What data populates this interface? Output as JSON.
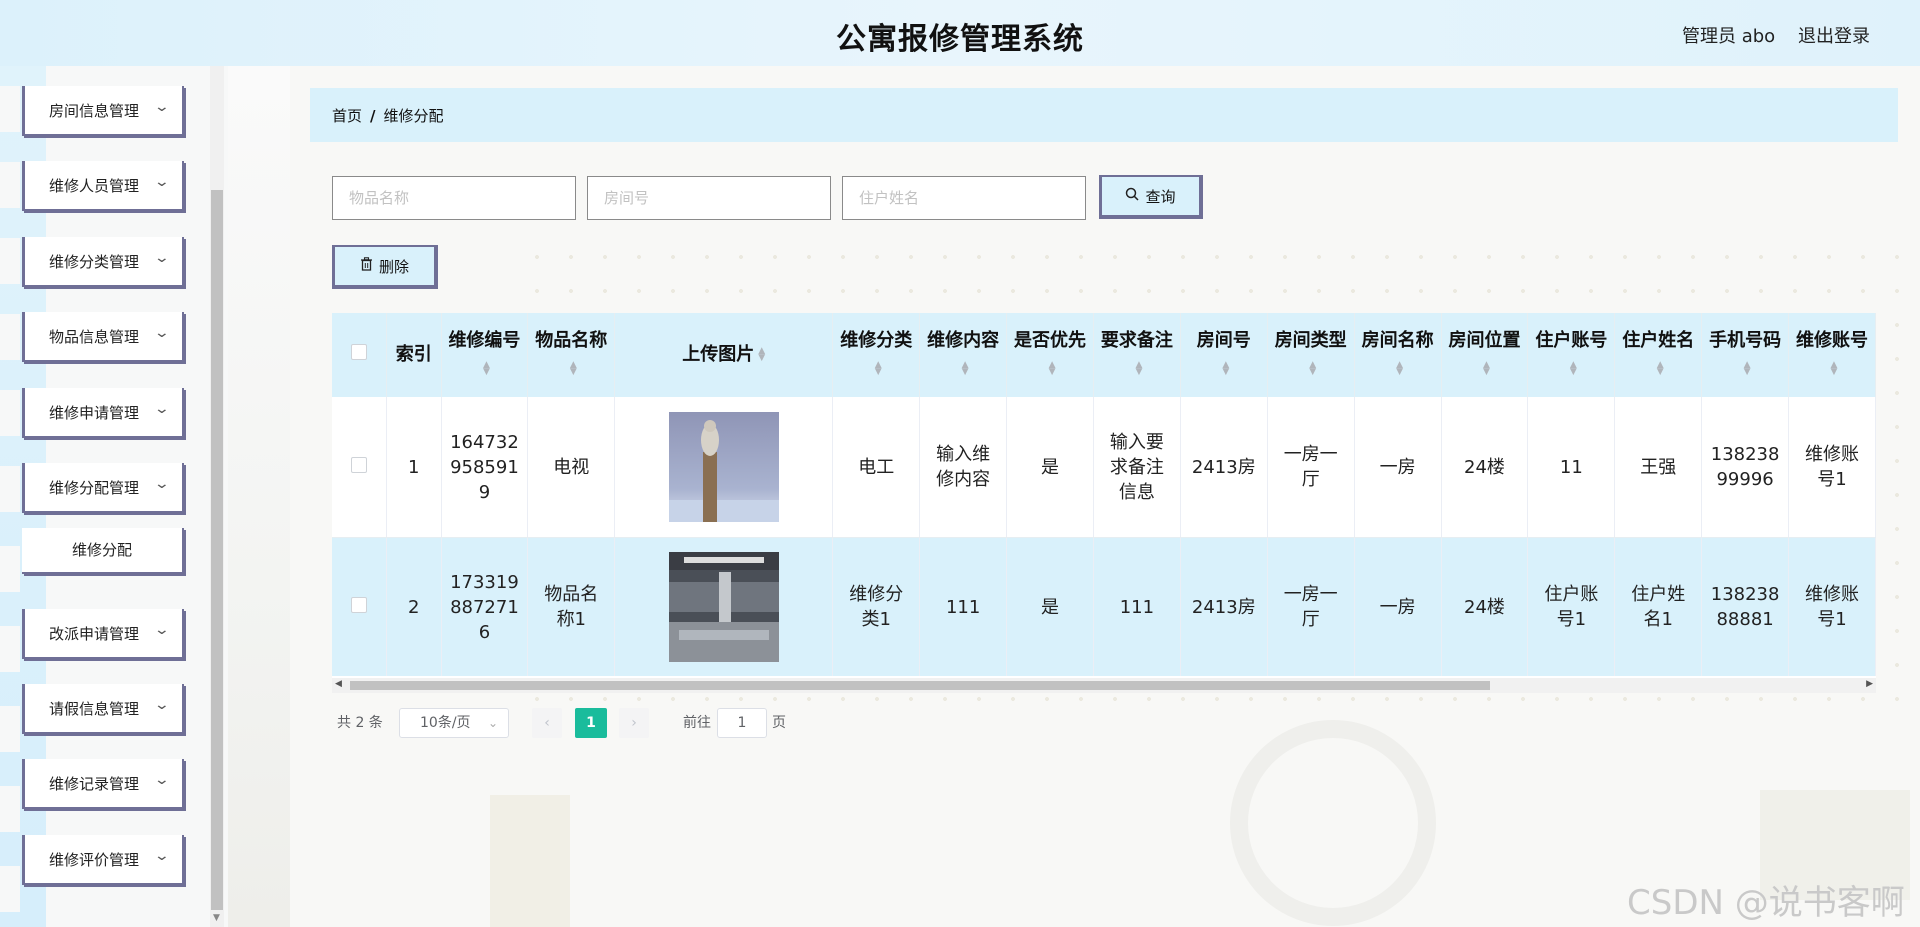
{
  "header": {
    "title": "公寓报修管理系统",
    "user_label": "管理员 abo",
    "logout_label": "退出登录"
  },
  "sidebar": {
    "items": [
      {
        "label": "房间信息管理"
      },
      {
        "label": "维修人员管理"
      },
      {
        "label": "维修分类管理"
      },
      {
        "label": "物品信息管理"
      },
      {
        "label": "维修申请管理"
      },
      {
        "label": "维修分配管理"
      },
      {
        "label": "改派申请管理"
      },
      {
        "label": "请假信息管理"
      },
      {
        "label": "维修记录管理"
      },
      {
        "label": "维修评价管理"
      }
    ],
    "sub_item": {
      "label": "维修分配"
    }
  },
  "breadcrumb": {
    "home": "首页",
    "separator": "/",
    "current": "维修分配"
  },
  "search": {
    "item_name_placeholder": "物品名称",
    "room_no_placeholder": "房间号",
    "resident_name_placeholder": "住户姓名",
    "query_label": "查询"
  },
  "toolbar": {
    "delete_label": "删除"
  },
  "table": {
    "columns": [
      {
        "label": "索引"
      },
      {
        "label": "维修编号"
      },
      {
        "label": "物品名称"
      },
      {
        "label": "上传图片"
      },
      {
        "label": "维修分类"
      },
      {
        "label": "维修内容"
      },
      {
        "label": "是否优先"
      },
      {
        "label": "要求备注"
      },
      {
        "label": "房间号"
      },
      {
        "label": "房间类型"
      },
      {
        "label": "房间名称"
      },
      {
        "label": "房间位置"
      },
      {
        "label": "住户账号"
      },
      {
        "label": "住户姓名"
      },
      {
        "label": "手机号码"
      },
      {
        "label": "维修账号"
      }
    ],
    "rows": [
      {
        "index": "1",
        "repair_no": "1647329585919",
        "item_name": "电视",
        "image": "photo-bird-on-post",
        "category": "电工",
        "content": "输入维修内容",
        "priority": "是",
        "remark": "输入要求备注信息",
        "room_no": "2413房",
        "room_type": "一房一厅",
        "room_name": "一房",
        "room_location": "24楼",
        "resident_account": "11",
        "resident_name": "王强",
        "phone": "13823899996",
        "repair_account": "维修账号1"
      },
      {
        "index": "2",
        "repair_no": "1733198872716",
        "item_name": "物品名称1",
        "image": "photo-bridge-city",
        "category": "维修分类1",
        "content": "111",
        "priority": "是",
        "remark": "111",
        "room_no": "2413房",
        "room_type": "一房一厅",
        "room_name": "一房",
        "room_location": "24楼",
        "resident_account": "住户账号1",
        "resident_name": "住户姓名1",
        "phone": "13823888881",
        "repair_account": "维修账号1"
      }
    ]
  },
  "pagination": {
    "total_label": "共 2 条",
    "page_size": "10条/页",
    "current_page": "1",
    "goto_label": "前往",
    "goto_value": "1",
    "page_suffix": "页"
  },
  "watermark": "CSDN @说书客啊",
  "colors": {
    "header_bg": "#dcf1fb",
    "accent_border": "#6f6f96",
    "table_header_bg": "#d9f1fb",
    "pager_active": "#1abc9c"
  }
}
